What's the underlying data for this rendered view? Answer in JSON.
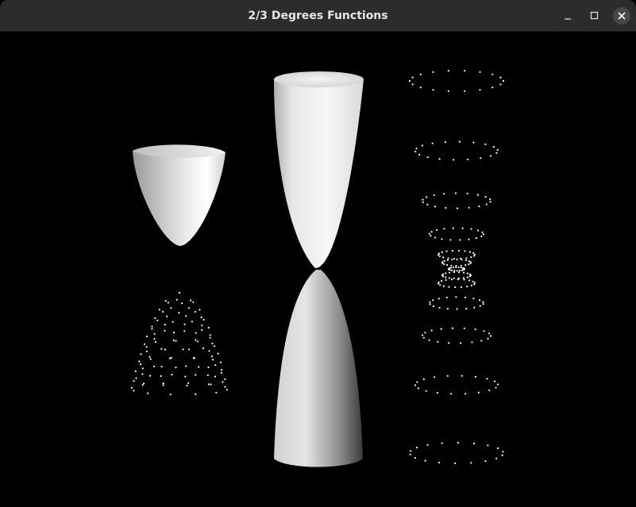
{
  "window": {
    "title": "2/3 Degrees Functions",
    "minimize_icon": "minimize-icon",
    "maximize_icon": "maximize-icon",
    "close_icon": "close-icon"
  },
  "colors": {
    "titlebar": "#2c2c2c",
    "title_text": "#e6e6e6",
    "background": "#000000",
    "surface_light": "#f4f4f4",
    "surface_dark": "#5a5a5a",
    "points": "#ffffff"
  },
  "scene": {
    "objects": [
      "shaded-paraboloid",
      "point-cloud-paraboloid",
      "shaded-hourglass",
      "point-cloud-hourglass-rings"
    ]
  }
}
